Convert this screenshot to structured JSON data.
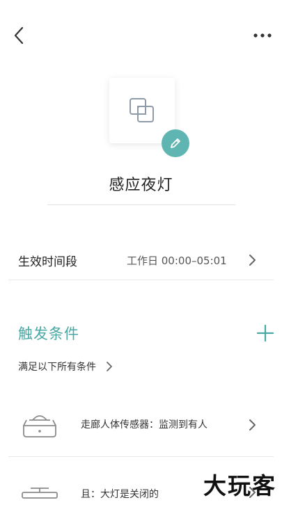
{
  "header": {
    "back_icon": "chevron-left-icon",
    "more_icon": "more-horizontal-icon"
  },
  "device": {
    "name": "感应夜灯",
    "icon": "overlapping-squares-icon",
    "edit_icon": "pencil-icon",
    "accent_color": "#5fb5b2"
  },
  "effective_time": {
    "label": "生效时间段",
    "value": "工作日 00:00–05:01"
  },
  "triggers": {
    "title": "触发条件",
    "title_color": "#4aa8a4",
    "add_icon": "plus-icon",
    "mode_label": "满足以下所有条件",
    "items": [
      {
        "icon": "motion-sensor-icon",
        "text": "走廊人体传感器：监测到有人"
      },
      {
        "icon": "ceiling-light-icon",
        "text": "且：大灯是关闭的"
      }
    ]
  },
  "watermark": "大玩客"
}
